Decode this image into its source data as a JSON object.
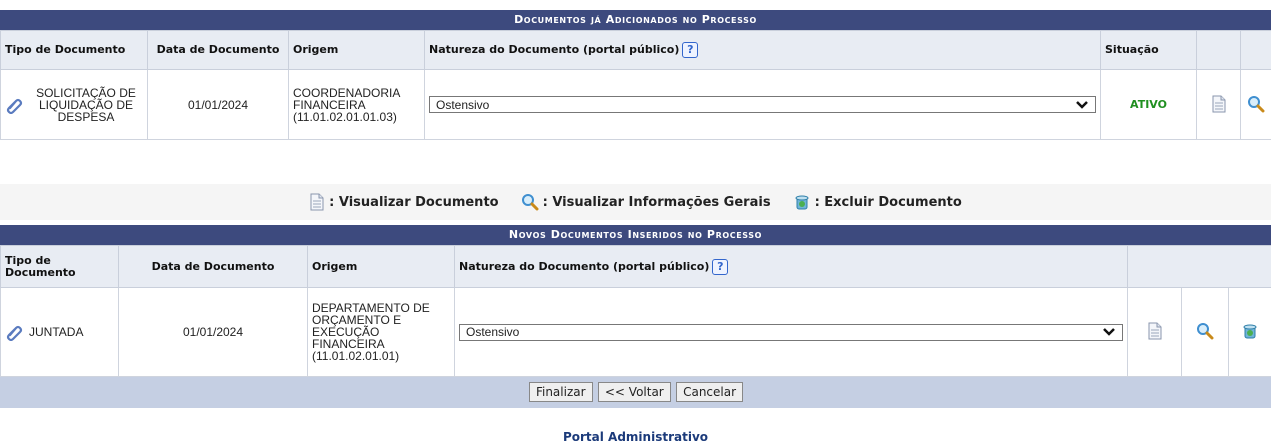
{
  "section1": {
    "title": "Documentos já Adicionados no Processo",
    "headers": [
      "Tipo de Documento",
      "Data de Documento",
      "Origem",
      "Natureza do Documento (portal público)",
      "Situação"
    ],
    "row": {
      "tipo": "SOLICITAÇÃO DE LIQUIDAÇÃO DE DESPESA",
      "data": "01/01/2024",
      "origem": "COORDENADORIA FINANCEIRA (11.01.02.01.01.03)",
      "natureza": "Ostensivo",
      "situacao": "ATIVO"
    },
    "help_label": "?"
  },
  "legend": {
    "view_doc": ": Visualizar Documento",
    "view_info": ": Visualizar Informações Gerais",
    "delete_doc": ": Excluir Documento"
  },
  "section2": {
    "title": "Novos Documentos Inseridos no Processo",
    "headers": [
      "Tipo de Documento",
      "Data de Documento",
      "Origem",
      "Natureza do Documento (portal público)"
    ],
    "row": {
      "tipo": "JUNTADA",
      "data": "01/01/2024",
      "origem": "DEPARTAMENTO DE ORÇAMENTO E EXECUÇÃO FINANCEIRA (11.01.02.01.01)",
      "natureza": "Ostensivo"
    },
    "help_label": "?"
  },
  "buttons": {
    "finalizar": "Finalizar",
    "voltar": "<< Voltar",
    "cancelar": "Cancelar"
  },
  "footer": {
    "portal": "Portal Administrativo"
  },
  "colors": {
    "caption_bg": "#3d4a7e",
    "header_bg": "#e8ecf3",
    "status_active": "#1f8f1f",
    "button_bar": "#c5cfe3"
  }
}
